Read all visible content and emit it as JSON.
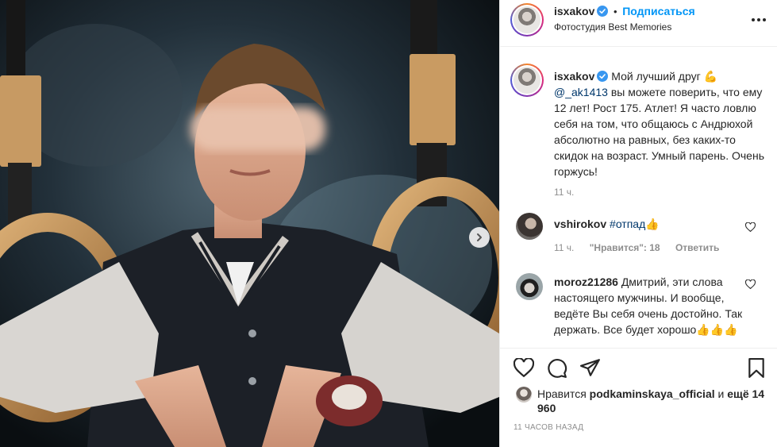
{
  "post": {
    "author": "isxakov",
    "follow_label": "Подписаться",
    "dot": "•",
    "location": "Фотостудия Best Memories",
    "more_icon": "more-icon"
  },
  "caption": {
    "username": "isxakov",
    "text_1": "Мой лучший друг",
    "mention": "@_ak1413",
    "text_2": "вы можете поверить, что ему 12 лет! Рост 175. Атлет! Я часто ловлю себя на том, что общаюсь с Андрюхой абсолютно на равных, без каких-то скидок на возраст. Умный парень. Очень горжусь!",
    "emoji": "💪",
    "time": "11 ч."
  },
  "comments": [
    {
      "username": "vshirokov",
      "hashtag": "#отпад",
      "emoji": "👍",
      "time": "11 ч.",
      "likes": "\"Нравится\": 18",
      "reply": "Ответить"
    },
    {
      "username": "moroz21286",
      "text": "Дмитрий, эти слова настоящего мужчины. И вообще, ведёте Вы себя очень достойно. Так держать. Все будет хорошо👍👍👍"
    }
  ],
  "likes": {
    "prefix": "Нравится",
    "user": "podkaminskaya_official",
    "conj": "и",
    "others": "ещё 14 960"
  },
  "timestamp": "11 ЧАСОВ НАЗАД",
  "colors": {
    "accent": "#0095f6",
    "link": "#00376b",
    "muted": "#8e8e8e",
    "verified": "#3897f0"
  }
}
